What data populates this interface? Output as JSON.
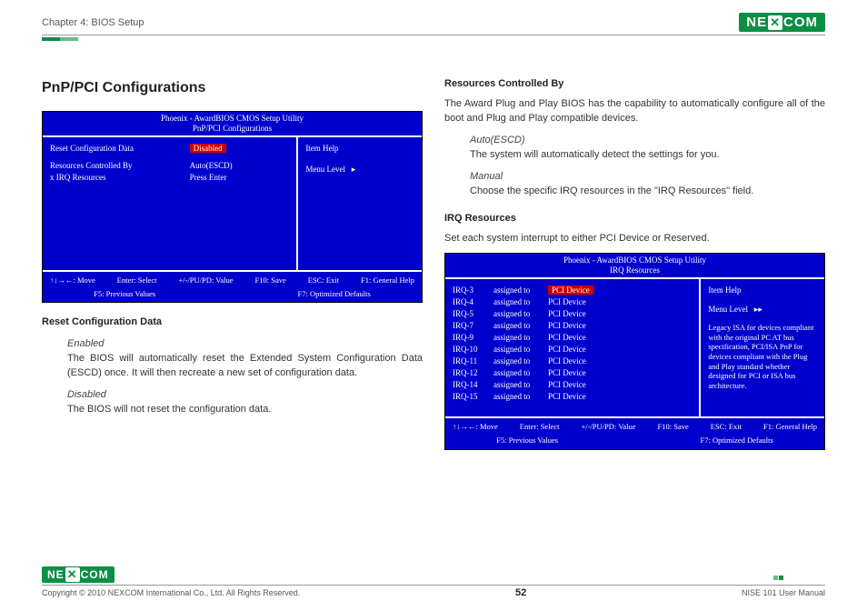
{
  "header": {
    "chapter": "Chapter 4: BIOS Setup",
    "brand": "NEXCOM"
  },
  "left": {
    "h2": "PnP/PCI Configurations",
    "bios1": {
      "title1": "Phoenix - AwardBIOS CMOS Setup Utility",
      "title2": "PnP/PCI Configurations",
      "row1_label": "Reset Configuration Data",
      "row1_value": "Disabled",
      "row2_label": "Resources Controlled By",
      "row2_value": "Auto(ESCD)",
      "row3_label": "x   IRQ Resources",
      "row3_value": "Press Enter",
      "help_title": "Item Help",
      "help_level": "Menu Level",
      "foot": {
        "move": "↑↓→←: Move",
        "enter": "Enter: Select",
        "pupd": "+/-/PU/PD: Value",
        "f10": "F10: Save",
        "esc": "ESC: Exit",
        "f1": "F1: General Help",
        "f5": "F5: Previous Values",
        "f7": "F7: Optimized Defaults"
      }
    },
    "sub1": "Reset Configuration Data",
    "enabled_l": "Enabled",
    "enabled_t": "The BIOS will automatically reset the Extended System Configuration Data (ESCD) once. It will then recreate a new set of configuration data.",
    "disabled_l": "Disabled",
    "disabled_t": "The BIOS will not reset the configuration data."
  },
  "right": {
    "sub2": "Resources Controlled By",
    "rcb_intro": "The Award Plug and Play BIOS has the capability to automatically configure all of the boot and Plug and Play compatible devices.",
    "auto_l": "Auto(ESCD)",
    "auto_t": "The system will automatically detect the settings for you.",
    "manual_l": "Manual",
    "manual_t": "Choose the specific IRQ resources in the \"IRQ Resources\" field.",
    "sub3": "IRQ Resources",
    "irq_intro": "Set each system interrupt to either PCI Device or Reserved.",
    "bios2": {
      "title1": "Phoenix - AwardBIOS CMOS Setup Utility",
      "title2": "IRQ Resources",
      "irqs": [
        "IRQ-3",
        "IRQ-4",
        "IRQ-5",
        "IRQ-7",
        "IRQ-9",
        "IRQ-10",
        "IRQ-11",
        "IRQ-12",
        "IRQ-14",
        "IRQ-15"
      ],
      "assigned": "assigned to",
      "pci": "PCI Device",
      "help_title": "Item Help",
      "help_level": "Menu Level",
      "help_text": "Legacy ISA for devices compliant with the original PC AT bus specification, PCI/ISA PnP for devices compliant with the Plug and Play standard whether designed for PCI or ISA bus architecture.",
      "foot": {
        "move": "↑↓→←: Move",
        "enter": "Enter: Select",
        "pupd": "+/-/PU/PD: Value",
        "f10": "F10: Save",
        "esc": "ESC: Exit",
        "f1": "F1: General Help",
        "f5": "F5: Previous Values",
        "f7": "F7: Optimized Defaults"
      }
    }
  },
  "footer": {
    "copyright": "Copyright © 2010 NEXCOM International Co., Ltd. All Rights Reserved.",
    "page": "52",
    "manual": "NISE 101 User Manual"
  }
}
